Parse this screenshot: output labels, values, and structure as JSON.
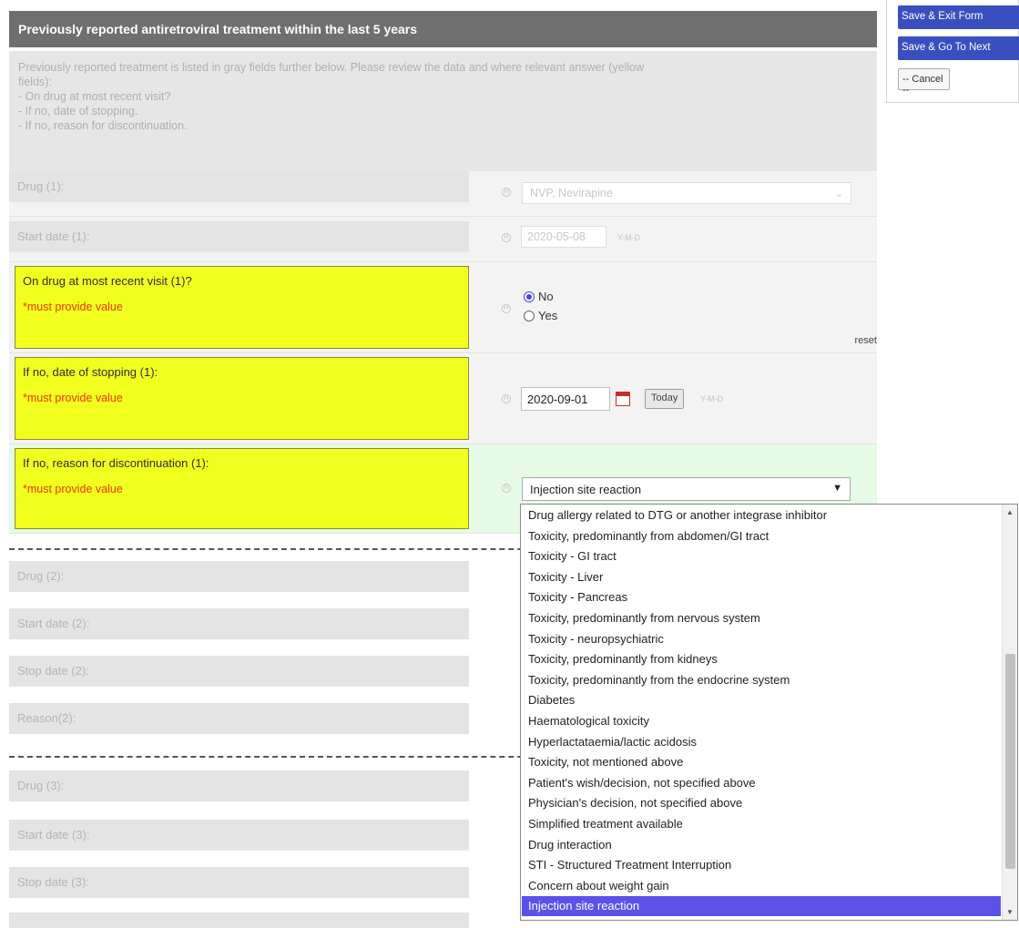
{
  "section": {
    "title": "Previously reported antiretroviral treatment within the last 5 years",
    "description_lines": [
      "Previously reported treatment is listed in gray fields further below. Please review the data and where relevant answer (yellow",
      "fields):",
      "- On drug at most recent visit?",
      "- If no, date of stopping.",
      "- If no, reason for discontinuation."
    ]
  },
  "rows": {
    "drug1": {
      "label": "Drug (1):",
      "value": "NVP, Nevirapine"
    },
    "start1": {
      "label": "Start date (1):",
      "value": "2020-05-08",
      "format": "Y-M-D"
    },
    "on_drug": {
      "label": "On drug at most recent visit (1)?",
      "required": "*must provide value",
      "options": [
        "No",
        "Yes"
      ],
      "selected": "No",
      "reset": "reset"
    },
    "stop_date": {
      "label": "If no, date of stopping (1):",
      "required": "*must provide value",
      "value": "2020-09-01",
      "today": "Today",
      "format": "Y-M-D"
    },
    "reason": {
      "label": "If no, reason for discontinuation (1):",
      "required": "*must provide value",
      "value": "Injection site reaction"
    },
    "drug2": {
      "label": "Drug (2):"
    },
    "start2": {
      "label": "Start date (2):"
    },
    "stop2": {
      "label": "Stop date (2):"
    },
    "reason2": {
      "label": "Reason(2):"
    },
    "drug3": {
      "label": "Drug (3):"
    },
    "start3": {
      "label": "Start date (3):"
    },
    "stop3": {
      "label": "Stop date (3):"
    }
  },
  "dropdown_options": [
    "Drug allergy related to DTG or another integrase inhibitor",
    "Toxicity, predominantly from abdomen/GI tract",
    "Toxicity - GI tract",
    "Toxicity - Liver",
    "Toxicity - Pancreas",
    "Toxicity, predominantly from nervous system",
    "Toxicity - neuropsychiatric",
    "Toxicity, predominantly from kidneys",
    "Toxicity, predominantly from the endocrine system",
    "Diabetes",
    "Haematological toxicity",
    "Hyperlactataemia/lactic acidosis",
    "Toxicity, not mentioned above",
    "Patient's wish/decision, not specified above",
    "Physician's decision, not specified above",
    "Simplified treatment available",
    "Drug interaction",
    "STI - Structured Treatment Interruption",
    "Concern about weight gain",
    "Injection site reaction"
  ],
  "dropdown_selected_index": 19,
  "side_panel": {
    "save_exit": "Save & Exit Form",
    "save_next": "Save & Go To Next",
    "cancel": "-- Cancel --"
  },
  "colors": {
    "header_bg": "#6f6f6f",
    "required_bg": "#f2ff1e",
    "required_text": "#e53b12",
    "selected_option": "#5a52e8",
    "side_button": "#3a4fbf"
  },
  "icons": [
    "history-icon",
    "calendar-icon",
    "chevron-down-icon"
  ]
}
